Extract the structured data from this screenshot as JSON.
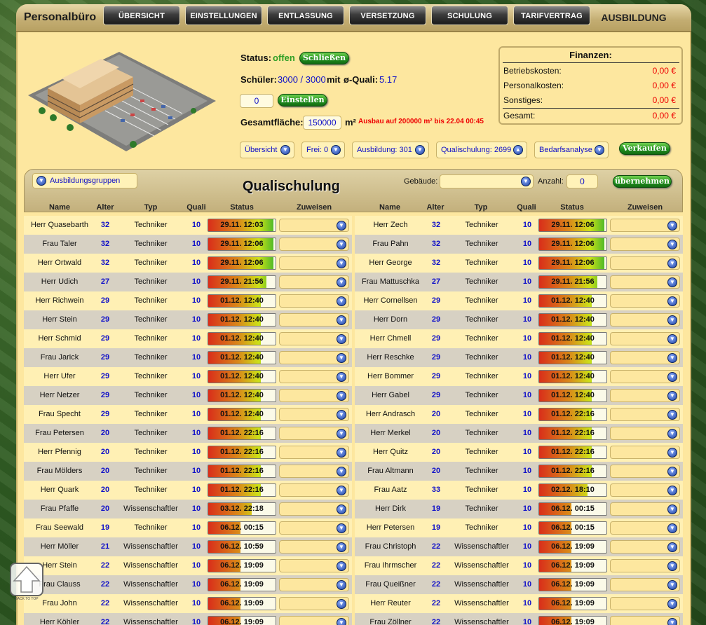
{
  "app": {
    "title": "Personalbüro",
    "active_tab": "AUSBILDUNG",
    "tabs": [
      "ÜBERSICHT",
      "EINSTELLUNGEN",
      "ENTLASSUNG",
      "VERSETZUNG",
      "SCHULUNG",
      "TARIFVERTRAG"
    ]
  },
  "status": {
    "label": "Status:",
    "value": "offen",
    "button": "Schließen"
  },
  "schueler": {
    "label": "Schüler:",
    "value": "3000 / 3000",
    "mit": "mit",
    "quali_label": "ø-Quali:",
    "quali": "5.17"
  },
  "hire": {
    "value": "0",
    "button": "Einstellen"
  },
  "flaeche": {
    "label": "Gesamtfläche:",
    "value": "150000",
    "unit": "m²",
    "notice": "Ausbau auf 200000 m² bis 22.04 00:45"
  },
  "finanzen": {
    "title": "Finanzen:",
    "rows": [
      {
        "label": "Betriebskosten:",
        "value": "0,00 €"
      },
      {
        "label": "Personalkosten:",
        "value": "0,00 €"
      },
      {
        "label": "Sonstiges:",
        "value": "0,00 €"
      },
      {
        "label": "Gesamt:",
        "value": "0,00 €"
      }
    ]
  },
  "filters": [
    "Übersicht",
    "Frei: 0",
    "Ausbildung: 301",
    "Qualischulung: 2699",
    "Bedarfsanalyse"
  ],
  "sell_button": "Verkaufen",
  "section": {
    "groups": "Ausbildungsgruppen",
    "title": "Qualischulung",
    "building_label": "Gebäude:",
    "count_label": "Anzahl:",
    "count_value": "0",
    "apply_button": "übernehmen"
  },
  "columns": [
    "Name",
    "Alter",
    "Typ",
    "Quali",
    "Status",
    "Zuweisen"
  ],
  "rows_left": [
    {
      "name": "Herr Quasebarth",
      "age": "32",
      "type": "Techniker",
      "quali": "10",
      "status": "29.11. 12:03",
      "progress": 0.97
    },
    {
      "name": "Frau Taler",
      "age": "32",
      "type": "Techniker",
      "quali": "10",
      "status": "29.11. 12:06",
      "progress": 0.97
    },
    {
      "name": "Herr Ortwald",
      "age": "32",
      "type": "Techniker",
      "quali": "10",
      "status": "29.11. 12:06",
      "progress": 0.97
    },
    {
      "name": "Herr Udich",
      "age": "27",
      "type": "Techniker",
      "quali": "10",
      "status": "29.11. 21:56",
      "progress": 0.86
    },
    {
      "name": "Herr Richwein",
      "age": "29",
      "type": "Techniker",
      "quali": "10",
      "status": "01.12. 12:40",
      "progress": 0.78
    },
    {
      "name": "Herr Stein",
      "age": "29",
      "type": "Techniker",
      "quali": "10",
      "status": "01.12. 12:40",
      "progress": 0.78
    },
    {
      "name": "Herr Schmid",
      "age": "29",
      "type": "Techniker",
      "quali": "10",
      "status": "01.12. 12:40",
      "progress": 0.78
    },
    {
      "name": "Frau Jarick",
      "age": "29",
      "type": "Techniker",
      "quali": "10",
      "status": "01.12. 12:40",
      "progress": 0.78
    },
    {
      "name": "Herr Ufer",
      "age": "29",
      "type": "Techniker",
      "quali": "10",
      "status": "01.12. 12:40",
      "progress": 0.78
    },
    {
      "name": "Herr Netzer",
      "age": "29",
      "type": "Techniker",
      "quali": "10",
      "status": "01.12. 12:40",
      "progress": 0.78
    },
    {
      "name": "Frau Specht",
      "age": "29",
      "type": "Techniker",
      "quali": "10",
      "status": "01.12. 12:40",
      "progress": 0.78
    },
    {
      "name": "Frau Petersen",
      "age": "20",
      "type": "Techniker",
      "quali": "10",
      "status": "01.12. 22:16",
      "progress": 0.78
    },
    {
      "name": "Herr Pfennig",
      "age": "20",
      "type": "Techniker",
      "quali": "10",
      "status": "01.12. 22:16",
      "progress": 0.78
    },
    {
      "name": "Frau Mölders",
      "age": "20",
      "type": "Techniker",
      "quali": "10",
      "status": "01.12. 22:16",
      "progress": 0.78
    },
    {
      "name": "Herr Quark",
      "age": "20",
      "type": "Techniker",
      "quali": "10",
      "status": "01.12. 22:16",
      "progress": 0.78
    },
    {
      "name": "Frau Pfaffe",
      "age": "20",
      "type": "Wissenschaftler",
      "quali": "10",
      "status": "03.12. 22:18",
      "progress": 0.65
    },
    {
      "name": "Frau Seewald",
      "age": "19",
      "type": "Techniker",
      "quali": "10",
      "status": "06.12. 00:15",
      "progress": 0.48
    },
    {
      "name": "Herr Möller",
      "age": "21",
      "type": "Wissenschaftler",
      "quali": "10",
      "status": "06.12. 10:59",
      "progress": 0.48
    },
    {
      "name": "Herr Stein",
      "age": "22",
      "type": "Wissenschaftler",
      "quali": "10",
      "status": "06.12. 19:09",
      "progress": 0.48
    },
    {
      "name": "Frau Clauss",
      "age": "22",
      "type": "Wissenschaftler",
      "quali": "10",
      "status": "06.12. 19:09",
      "progress": 0.48
    },
    {
      "name": "Frau John",
      "age": "22",
      "type": "Wissenschaftler",
      "quali": "10",
      "status": "06.12. 19:09",
      "progress": 0.48
    },
    {
      "name": "Herr Köhler",
      "age": "22",
      "type": "Wissenschaftler",
      "quali": "10",
      "status": "06.12. 19:09",
      "progress": 0.48
    }
  ],
  "rows_right": [
    {
      "name": "Herr Zech",
      "age": "32",
      "type": "Techniker",
      "quali": "10",
      "status": "29.11. 12:06",
      "progress": 0.97
    },
    {
      "name": "Frau Pahn",
      "age": "32",
      "type": "Techniker",
      "quali": "10",
      "status": "29.11. 12:06",
      "progress": 0.97
    },
    {
      "name": "Herr George",
      "age": "32",
      "type": "Techniker",
      "quali": "10",
      "status": "29.11. 12:06",
      "progress": 0.97
    },
    {
      "name": "Frau Mattuschka",
      "age": "27",
      "type": "Techniker",
      "quali": "10",
      "status": "29.11. 21:56",
      "progress": 0.86
    },
    {
      "name": "Herr Cornellsen",
      "age": "29",
      "type": "Techniker",
      "quali": "10",
      "status": "01.12. 12:40",
      "progress": 0.78
    },
    {
      "name": "Herr Dorn",
      "age": "29",
      "type": "Techniker",
      "quali": "10",
      "status": "01.12. 12:40",
      "progress": 0.78
    },
    {
      "name": "Herr Chmell",
      "age": "29",
      "type": "Techniker",
      "quali": "10",
      "status": "01.12. 12:40",
      "progress": 0.78
    },
    {
      "name": "Herr Reschke",
      "age": "29",
      "type": "Techniker",
      "quali": "10",
      "status": "01.12. 12:40",
      "progress": 0.78
    },
    {
      "name": "Herr Bommer",
      "age": "29",
      "type": "Techniker",
      "quali": "10",
      "status": "01.12. 12:40",
      "progress": 0.78
    },
    {
      "name": "Herr Gabel",
      "age": "29",
      "type": "Techniker",
      "quali": "10",
      "status": "01.12. 12:40",
      "progress": 0.78
    },
    {
      "name": "Herr Andrasch",
      "age": "20",
      "type": "Techniker",
      "quali": "10",
      "status": "01.12. 22:16",
      "progress": 0.78
    },
    {
      "name": "Herr Merkel",
      "age": "20",
      "type": "Techniker",
      "quali": "10",
      "status": "01.12. 22:16",
      "progress": 0.78
    },
    {
      "name": "Herr Quitz",
      "age": "20",
      "type": "Techniker",
      "quali": "10",
      "status": "01.12. 22:16",
      "progress": 0.78
    },
    {
      "name": "Frau Altmann",
      "age": "20",
      "type": "Techniker",
      "quali": "10",
      "status": "01.12. 22:16",
      "progress": 0.78
    },
    {
      "name": "Frau Aatz",
      "age": "33",
      "type": "Techniker",
      "quali": "10",
      "status": "02.12. 18:10",
      "progress": 0.72
    },
    {
      "name": "Herr Dirk",
      "age": "19",
      "type": "Techniker",
      "quali": "10",
      "status": "06.12. 00:15",
      "progress": 0.48
    },
    {
      "name": "Herr Petersen",
      "age": "19",
      "type": "Techniker",
      "quali": "10",
      "status": "06.12. 00:15",
      "progress": 0.48
    },
    {
      "name": "Frau Christoph",
      "age": "22",
      "type": "Wissenschaftler",
      "quali": "10",
      "status": "06.12. 19:09",
      "progress": 0.48
    },
    {
      "name": "Frau Ihrmscher",
      "age": "22",
      "type": "Wissenschaftler",
      "quali": "10",
      "status": "06.12. 19:09",
      "progress": 0.48
    },
    {
      "name": "Frau Queißner",
      "age": "22",
      "type": "Wissenschaftler",
      "quali": "10",
      "status": "06.12. 19:09",
      "progress": 0.48
    },
    {
      "name": "Herr Reuter",
      "age": "22",
      "type": "Wissenschaftler",
      "quali": "10",
      "status": "06.12. 19:09",
      "progress": 0.48
    },
    {
      "name": "Frau Zöllner",
      "age": "22",
      "type": "Wissenschaftler",
      "quali": "10",
      "status": "06.12. 19:09",
      "progress": 0.48
    }
  ],
  "back_to_top": "BACK TO TOP"
}
